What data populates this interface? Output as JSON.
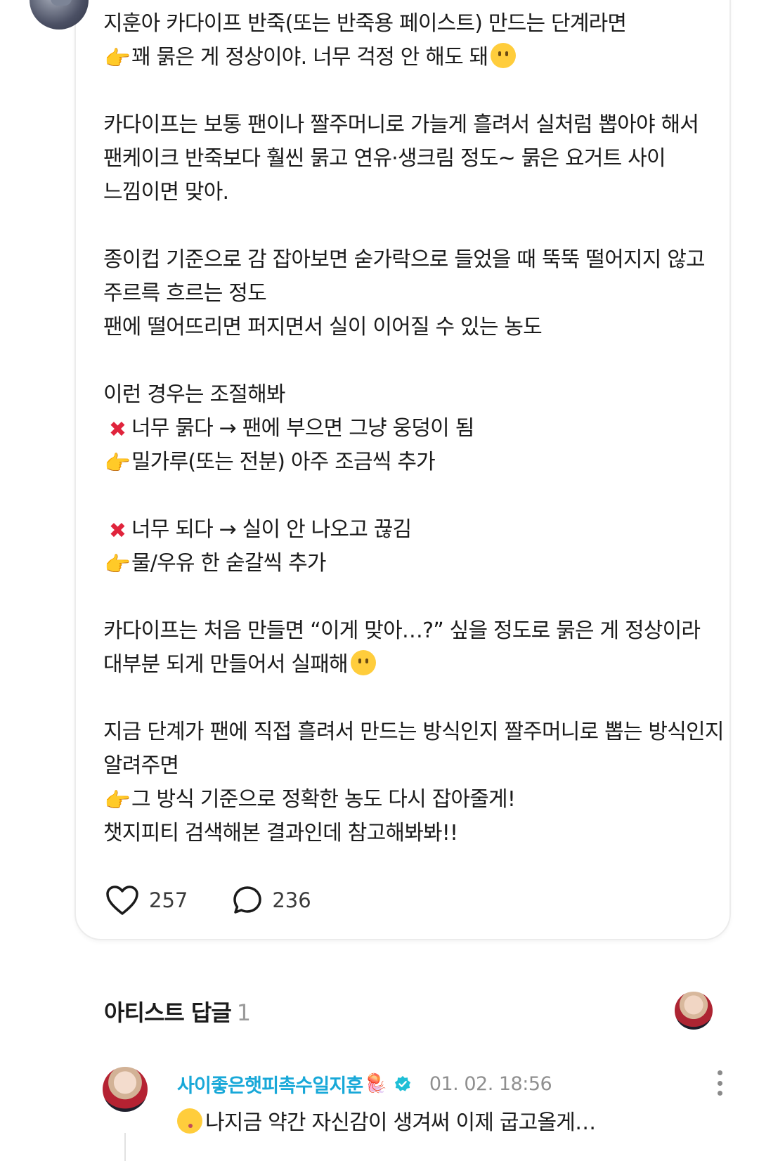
{
  "post": {
    "lines": {
      "l1": "지훈아 카다이프 반죽(또는 반죽용 페이스트) 만드는 단계라면",
      "l2": "꽤 묽은 게 정상이야. 너무 걱정 안 해도 돼",
      "l3": "카다이프는 보통 팬이나 짤주머니로 가늘게 흘려서 실처럼 뽑아야 해서",
      "l4": "팬케이크 반죽보다 훨씬 묽고 연유·생크림 정도~ 묽은 요거트 사이",
      "l5": "느낌이면 맞아.",
      "l6": "종이컵 기준으로 감 잡아보면 숟가락으로 들었을 때 뚝뚝 떨어지지 않고",
      "l7": "주르륵 흐르는 정도",
      "l8": "팬에 떨어뜨리면 퍼지면서 실이 이어질 수 있는 농도",
      "l9": "이런 경우는 조절해봐",
      "l10": "너무 묽다 → 팬에 부으면 그냥 웅덩이 됨",
      "l11": "밀가루(또는 전분) 아주 조금씩 추가",
      "l12": "너무 되다 → 실이 안 나오고 끊김",
      "l13": "물/우유 한 숟갈씩 추가",
      "l14": "카다이프는 처음 만들면 “이게 맞아…?” 싶을 정도로 묽은 게 정상이라",
      "l15": "대부분 되게 만들어서 실패해",
      "l16": "지금 단계가 팬에 직접 흘려서 만드는 방식인지 짤주머니로 뽑는 방식인지",
      "l17": "알려주면",
      "l18": "그 방식 기준으로 정확한 농도 다시 잡아줄게!",
      "l19": "챗지피티 검색해본 결과인데 참고해봐봐!!"
    },
    "likes": "257",
    "comments": "236"
  },
  "section": {
    "title": "아티스트 답글",
    "count": "1"
  },
  "comment": {
    "author": "사이좋은햇피촉수일지훈",
    "time": "01. 02. 18:56",
    "text": "나지금 약간 자신감이 생겨써 이제 굽고올게…"
  },
  "emoji": {
    "point": "👉",
    "cross": "✖",
    "jelly": "🪼"
  },
  "colors": {
    "author": "#18a8d8",
    "verified": "#1fbfd6",
    "cross": "#e0243c",
    "point": "#f4b400"
  }
}
